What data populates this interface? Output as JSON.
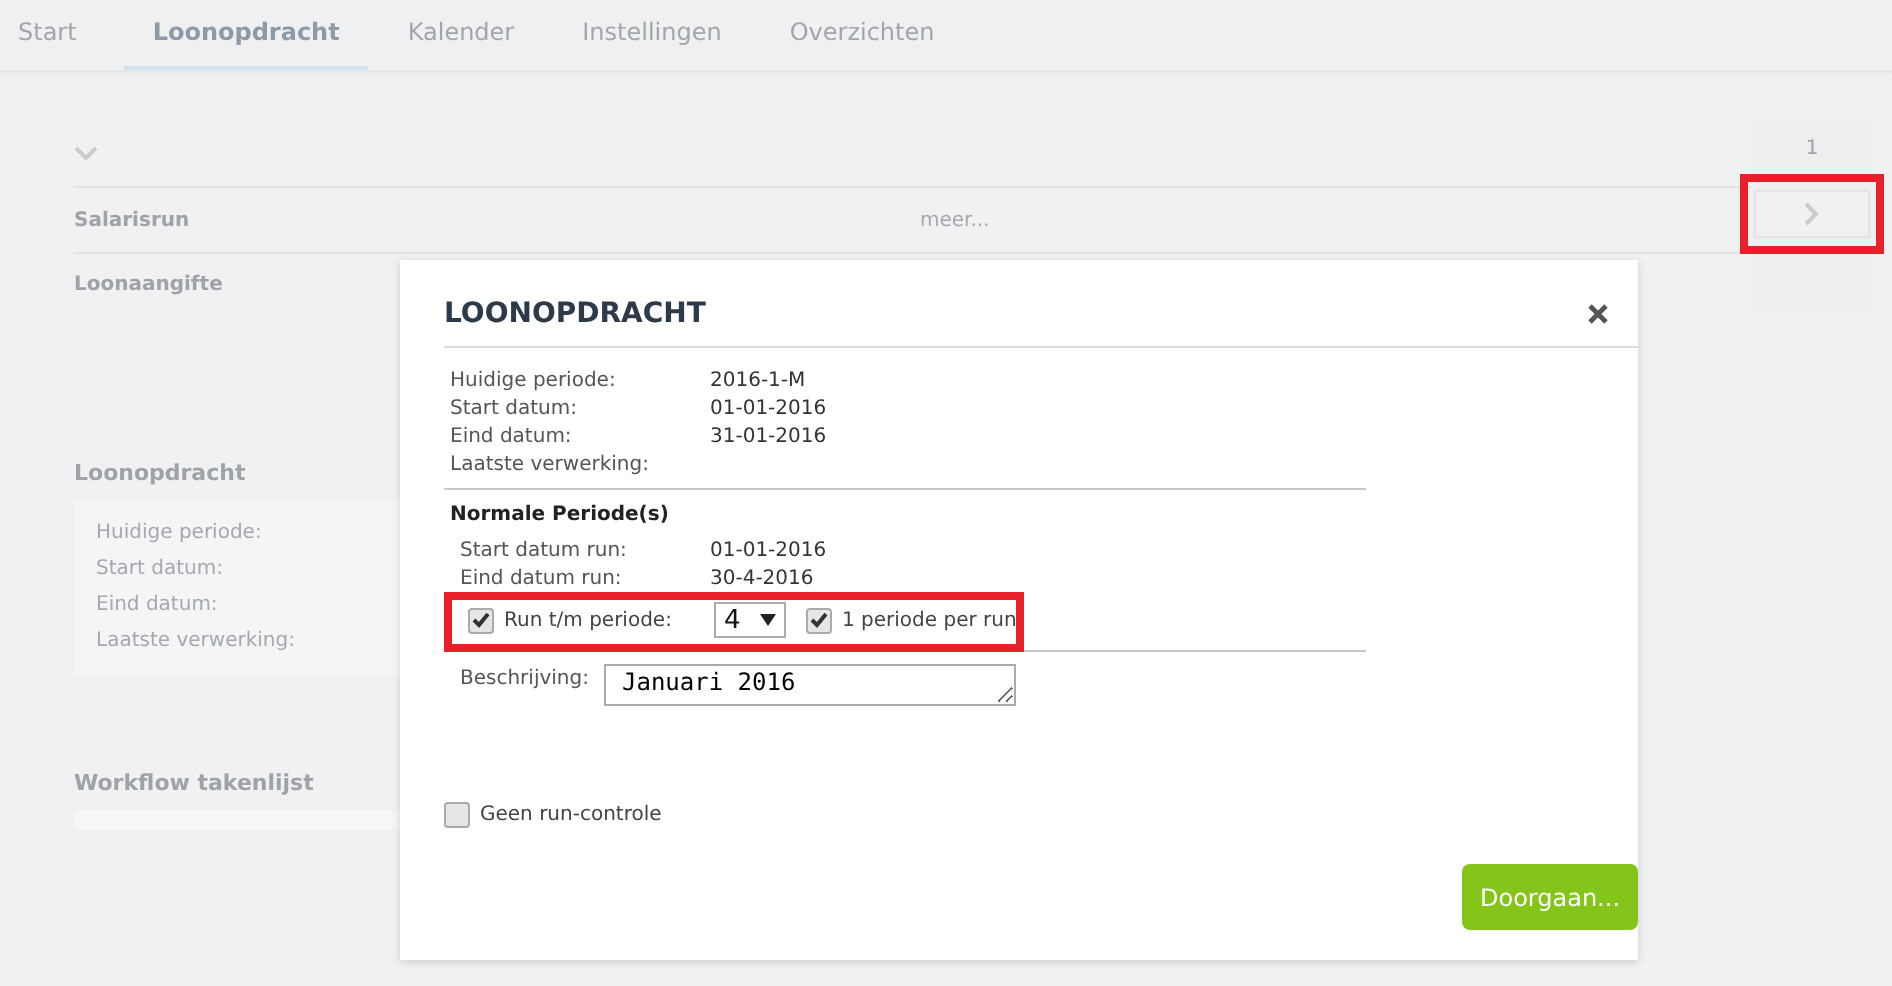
{
  "tabs": [
    {
      "label": "Start",
      "selected": false
    },
    {
      "label": "Loonopdracht",
      "selected": true
    },
    {
      "label": "Kalender",
      "selected": false
    },
    {
      "label": "Instellingen",
      "selected": false
    },
    {
      "label": "Overzichten",
      "selected": false
    }
  ],
  "overview": {
    "column_header": "1",
    "rows": [
      {
        "label": "Salarisrun",
        "link": "meer...",
        "highlighted": true
      },
      {
        "label": "Loonaangifte"
      }
    ]
  },
  "loonopdracht_panel": {
    "title": "Loonopdracht",
    "fields": [
      "Huidige periode:",
      "Start datum:",
      "Eind datum:",
      "Laatste verwerking:"
    ]
  },
  "workflow": {
    "title": "Workflow takenlijst"
  },
  "dialog": {
    "title": "LOONOPDRACHT",
    "info": [
      {
        "label": "Huidige periode:",
        "value": "2016-1-M"
      },
      {
        "label": "Start datum:",
        "value": "01-01-2016"
      },
      {
        "label": "Eind datum:",
        "value": "31-01-2016"
      },
      {
        "label": "Laatste verwerking:"
      }
    ],
    "section_title": "Normale Periode(s)",
    "run_info": [
      {
        "label": "Start datum run:",
        "value": "01-01-2016"
      },
      {
        "label": "Eind datum run:",
        "value": "30-4-2016"
      }
    ],
    "run_until": {
      "label": "Run t/m periode:",
      "checked": true,
      "value": "4",
      "highlighted": true
    },
    "one_per_run": {
      "label": "1 periode per run",
      "checked": true
    },
    "description": {
      "label": "Beschrijving:",
      "value": "Januari 2016"
    },
    "no_check": {
      "label": "Geen run-controle",
      "checked": false
    },
    "button": "Doorgaan..."
  }
}
